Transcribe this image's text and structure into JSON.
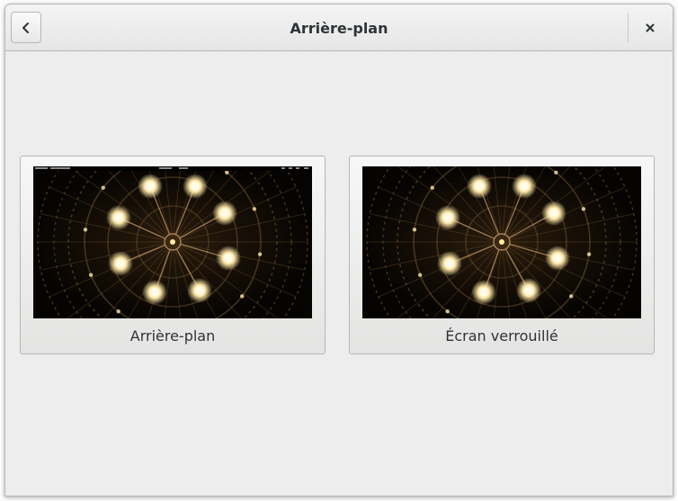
{
  "header": {
    "title": "Arrière-plan",
    "back_icon": "chevron-left-icon",
    "close_icon": "close-icon"
  },
  "cards": [
    {
      "label": "Arrière-plan",
      "shows_top_bar": true
    },
    {
      "label": "Écran verrouillé",
      "shows_top_bar": false
    }
  ],
  "colors": {
    "window_bg": "#ededed",
    "text": "#2e3436",
    "border": "#b6b6b3",
    "wallpaper_glow": "#ffe9a8",
    "wallpaper_metal": "#8a6a3a"
  }
}
